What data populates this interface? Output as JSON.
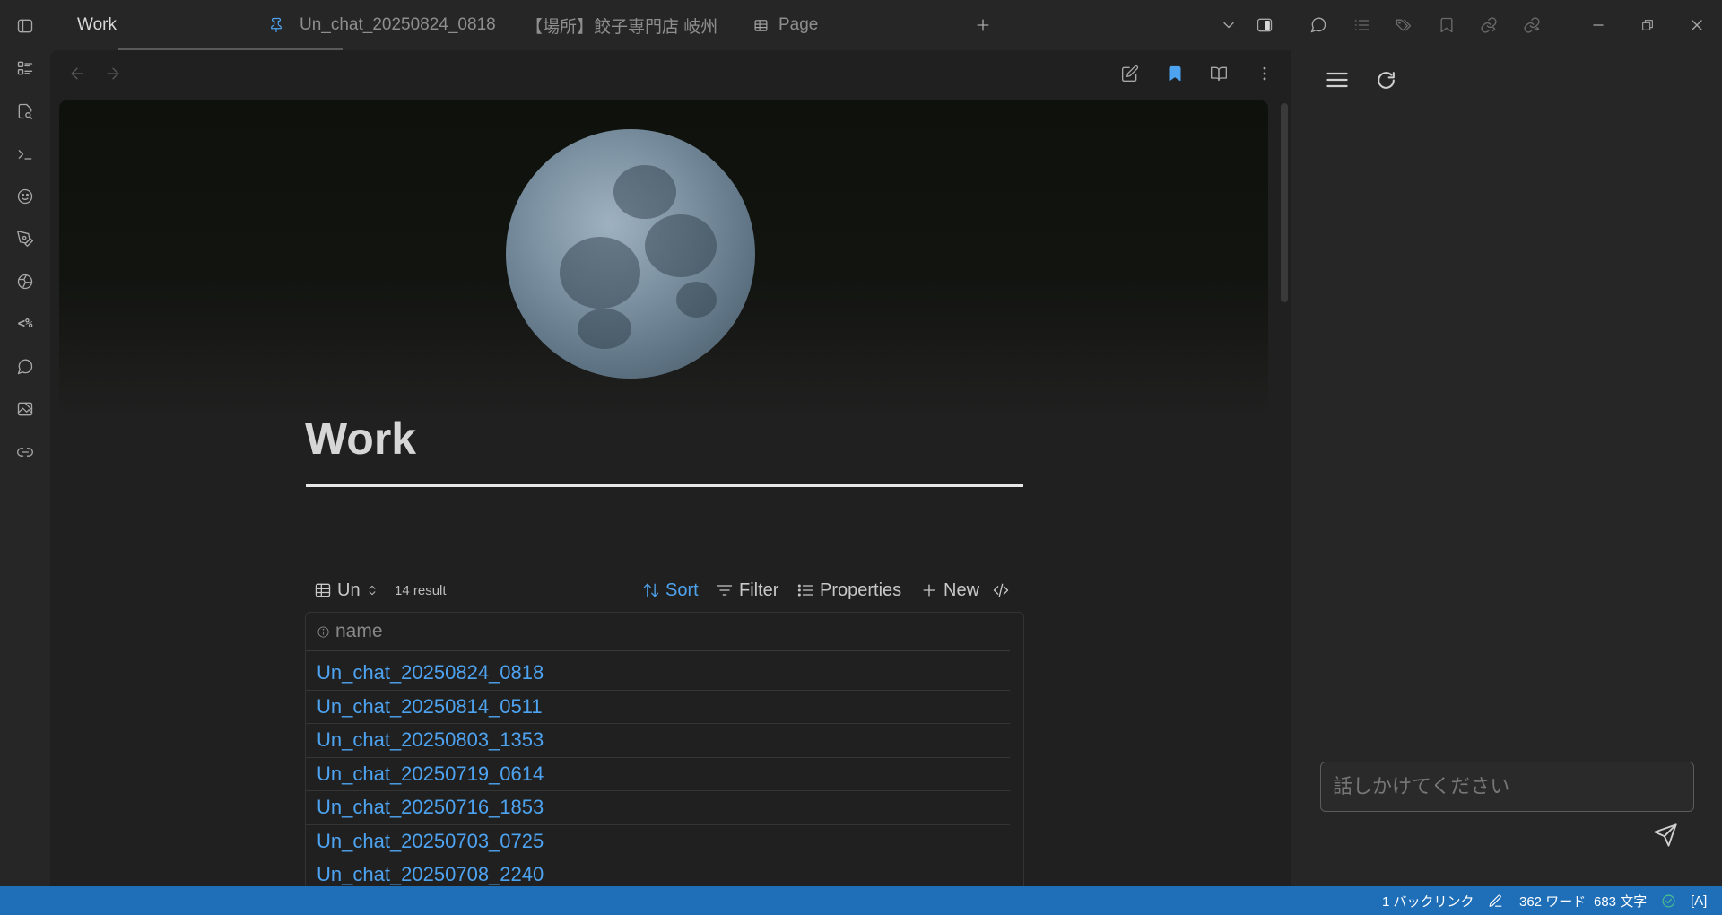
{
  "tabs": [
    {
      "label": "Work",
      "active": true
    },
    {
      "label": "Un_chat_20250824_0818",
      "pinned": true
    },
    {
      "label": "【場所】餃子専門店 岐州"
    },
    {
      "label": "Page"
    }
  ],
  "note": {
    "title": "Work"
  },
  "base": {
    "view_name": "Un",
    "result_count": "14 result",
    "sort_label": "Sort",
    "filter_label": "Filter",
    "properties_label": "Properties",
    "new_label": "New",
    "column_header": "name",
    "rows": [
      "Un_chat_20250824_0818",
      "Un_chat_20250814_0511",
      "Un_chat_20250803_1353",
      "Un_chat_20250719_0614",
      "Un_chat_20250716_1853",
      "Un_chat_20250703_0725",
      "Un_chat_20250708_2240"
    ]
  },
  "chat": {
    "placeholder": "話しかけてください"
  },
  "status": {
    "backlinks": "1 バックリンク",
    "words": "362 ワード",
    "chars": "683 文字",
    "mode": "[A]"
  },
  "colors": {
    "accent": "#4ea3f0",
    "status_bar": "#1f6fb8",
    "sync_ok": "#4cc38a"
  }
}
